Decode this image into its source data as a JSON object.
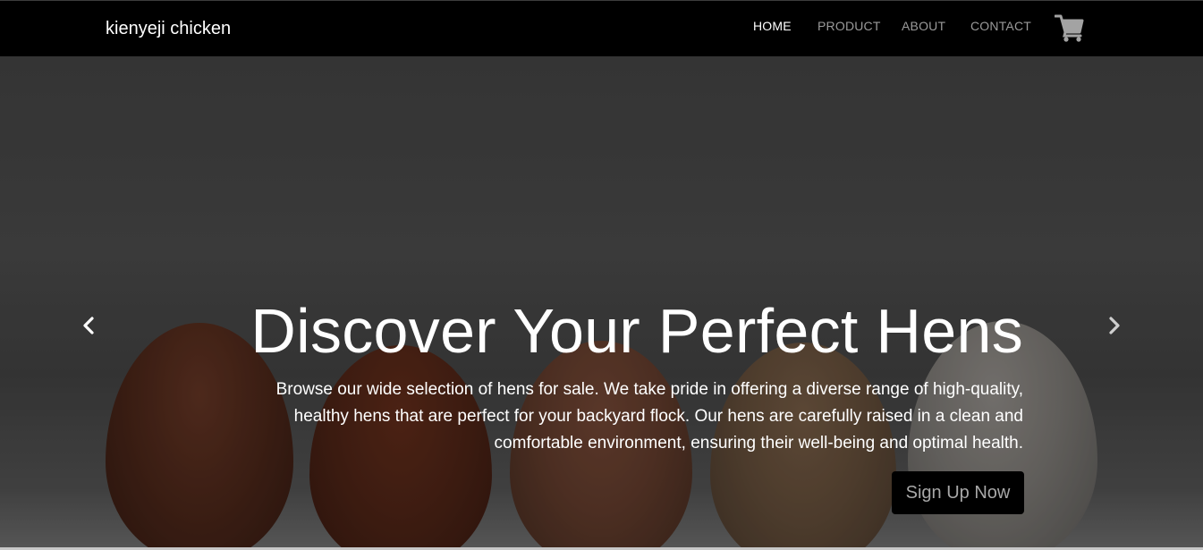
{
  "brand": "kienyeji chicken",
  "nav": {
    "items": [
      {
        "label": "HOME",
        "active": true
      },
      {
        "label": "PRODUCT",
        "active": false
      },
      {
        "label": "ABOUT",
        "active": false
      },
      {
        "label": "CONTACT",
        "active": false
      }
    ],
    "cart_icon": "shopping-cart-icon"
  },
  "hero": {
    "headline": "Discover Your Perfect Hens",
    "description": "Browse our wide selection of hens for sale. We take pride in offering a diverse range of high-quality, healthy hens that are perfect for your backyard flock. Our hens are carefully raised in a clean and comfortable environment, ensuring their well-being and optimal health.",
    "cta_label": "Sign Up Now",
    "prev_icon": "chevron-left-icon",
    "next_icon": "chevron-right-icon"
  },
  "colors": {
    "navbar_bg": "#000000",
    "nav_active": "#ffffff",
    "nav_inactive": "#9a9a9a",
    "button_bg": "#000000",
    "button_text": "#a8a8a8"
  }
}
